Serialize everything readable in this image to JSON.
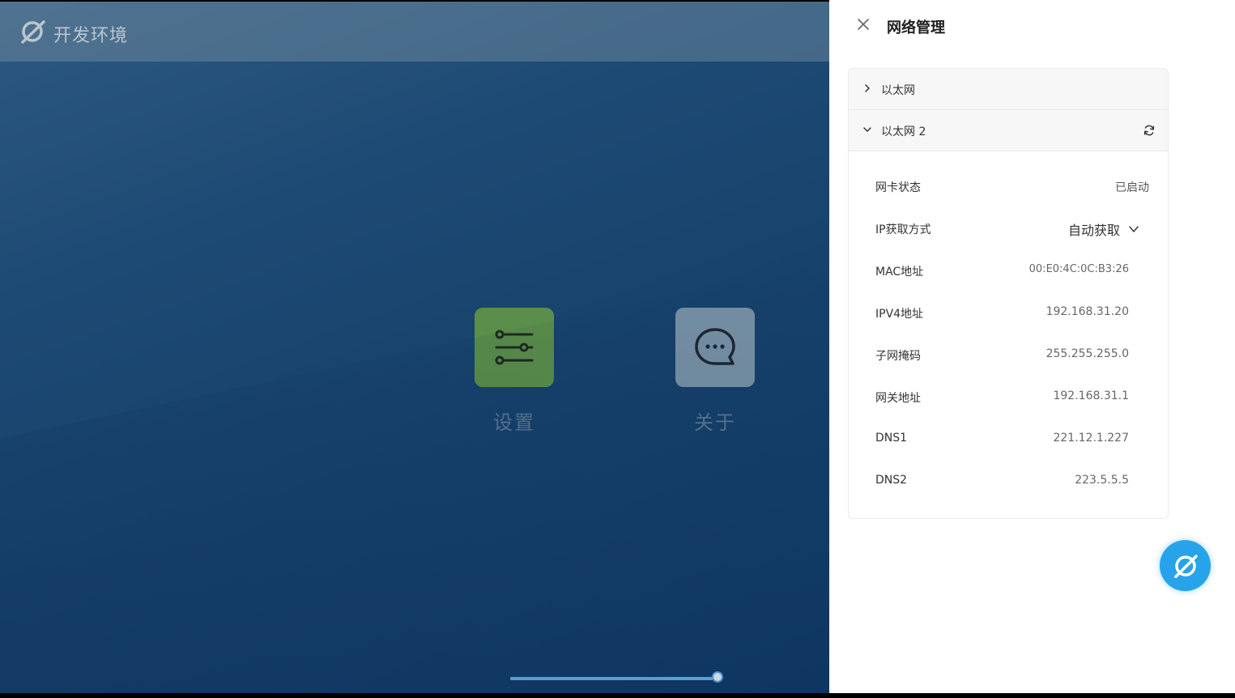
{
  "desktop": {
    "title": "开发环境",
    "apps": [
      {
        "label": "设置",
        "icon": "sliders-icon"
      },
      {
        "label": "关于",
        "icon": "chat-bubble-icon"
      }
    ],
    "slider": {
      "value": 1.0
    }
  },
  "panel": {
    "title": "网络管理",
    "sections": [
      {
        "label": "以太网",
        "expanded": false
      },
      {
        "label": "以太网 2",
        "expanded": true
      }
    ],
    "details": {
      "nic_status_label": "网卡状态",
      "nic_status_value": "已启动",
      "ip_mode_label": "IP获取方式",
      "ip_mode_value": "自动获取",
      "mac_label": "MAC地址",
      "mac_value": "00:E0:4C:0C:B3:26",
      "ipv4_label": "IPV4地址",
      "ipv4_value": "192.168.31.20",
      "mask_label": "子网掩码",
      "mask_value": "255.255.255.0",
      "gateway_label": "网关地址",
      "gateway_value": "192.168.31.1",
      "dns1_label": "DNS1",
      "dns1_value": "221.12.1.227",
      "dns2_label": "DNS2",
      "dns2_value": "223.5.5.5"
    }
  },
  "colors": {
    "accent": "#27a3ea",
    "settings_tile": "#5b8e4a",
    "about_tile": "#7891a6",
    "desktop_bg": "#1d4a74"
  }
}
